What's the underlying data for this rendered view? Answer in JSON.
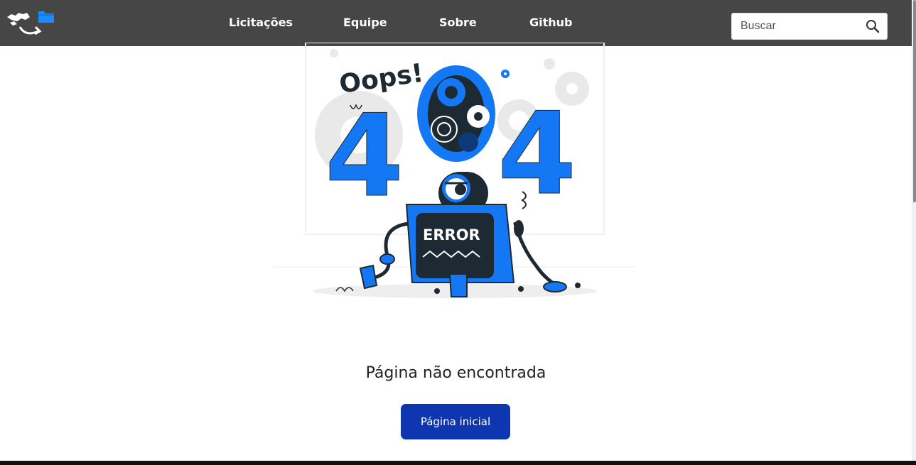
{
  "nav": {
    "links": [
      "Licitações",
      "Equipe",
      "Sobre",
      "Github"
    ],
    "search_placeholder": "Buscar",
    "search_icon": "search-icon",
    "logo_icon": "logo-icon"
  },
  "illustration": {
    "oops_text": "Oops!",
    "code_left": "4",
    "code_right": "4",
    "screen_text": "ERROR"
  },
  "main": {
    "message": "Página não encontrada",
    "home_button": "Página inicial"
  },
  "colors": {
    "navbar": "#464646",
    "accent_blue": "#1478f5",
    "button": "#0d36b0",
    "dark": "#1d2a33"
  }
}
